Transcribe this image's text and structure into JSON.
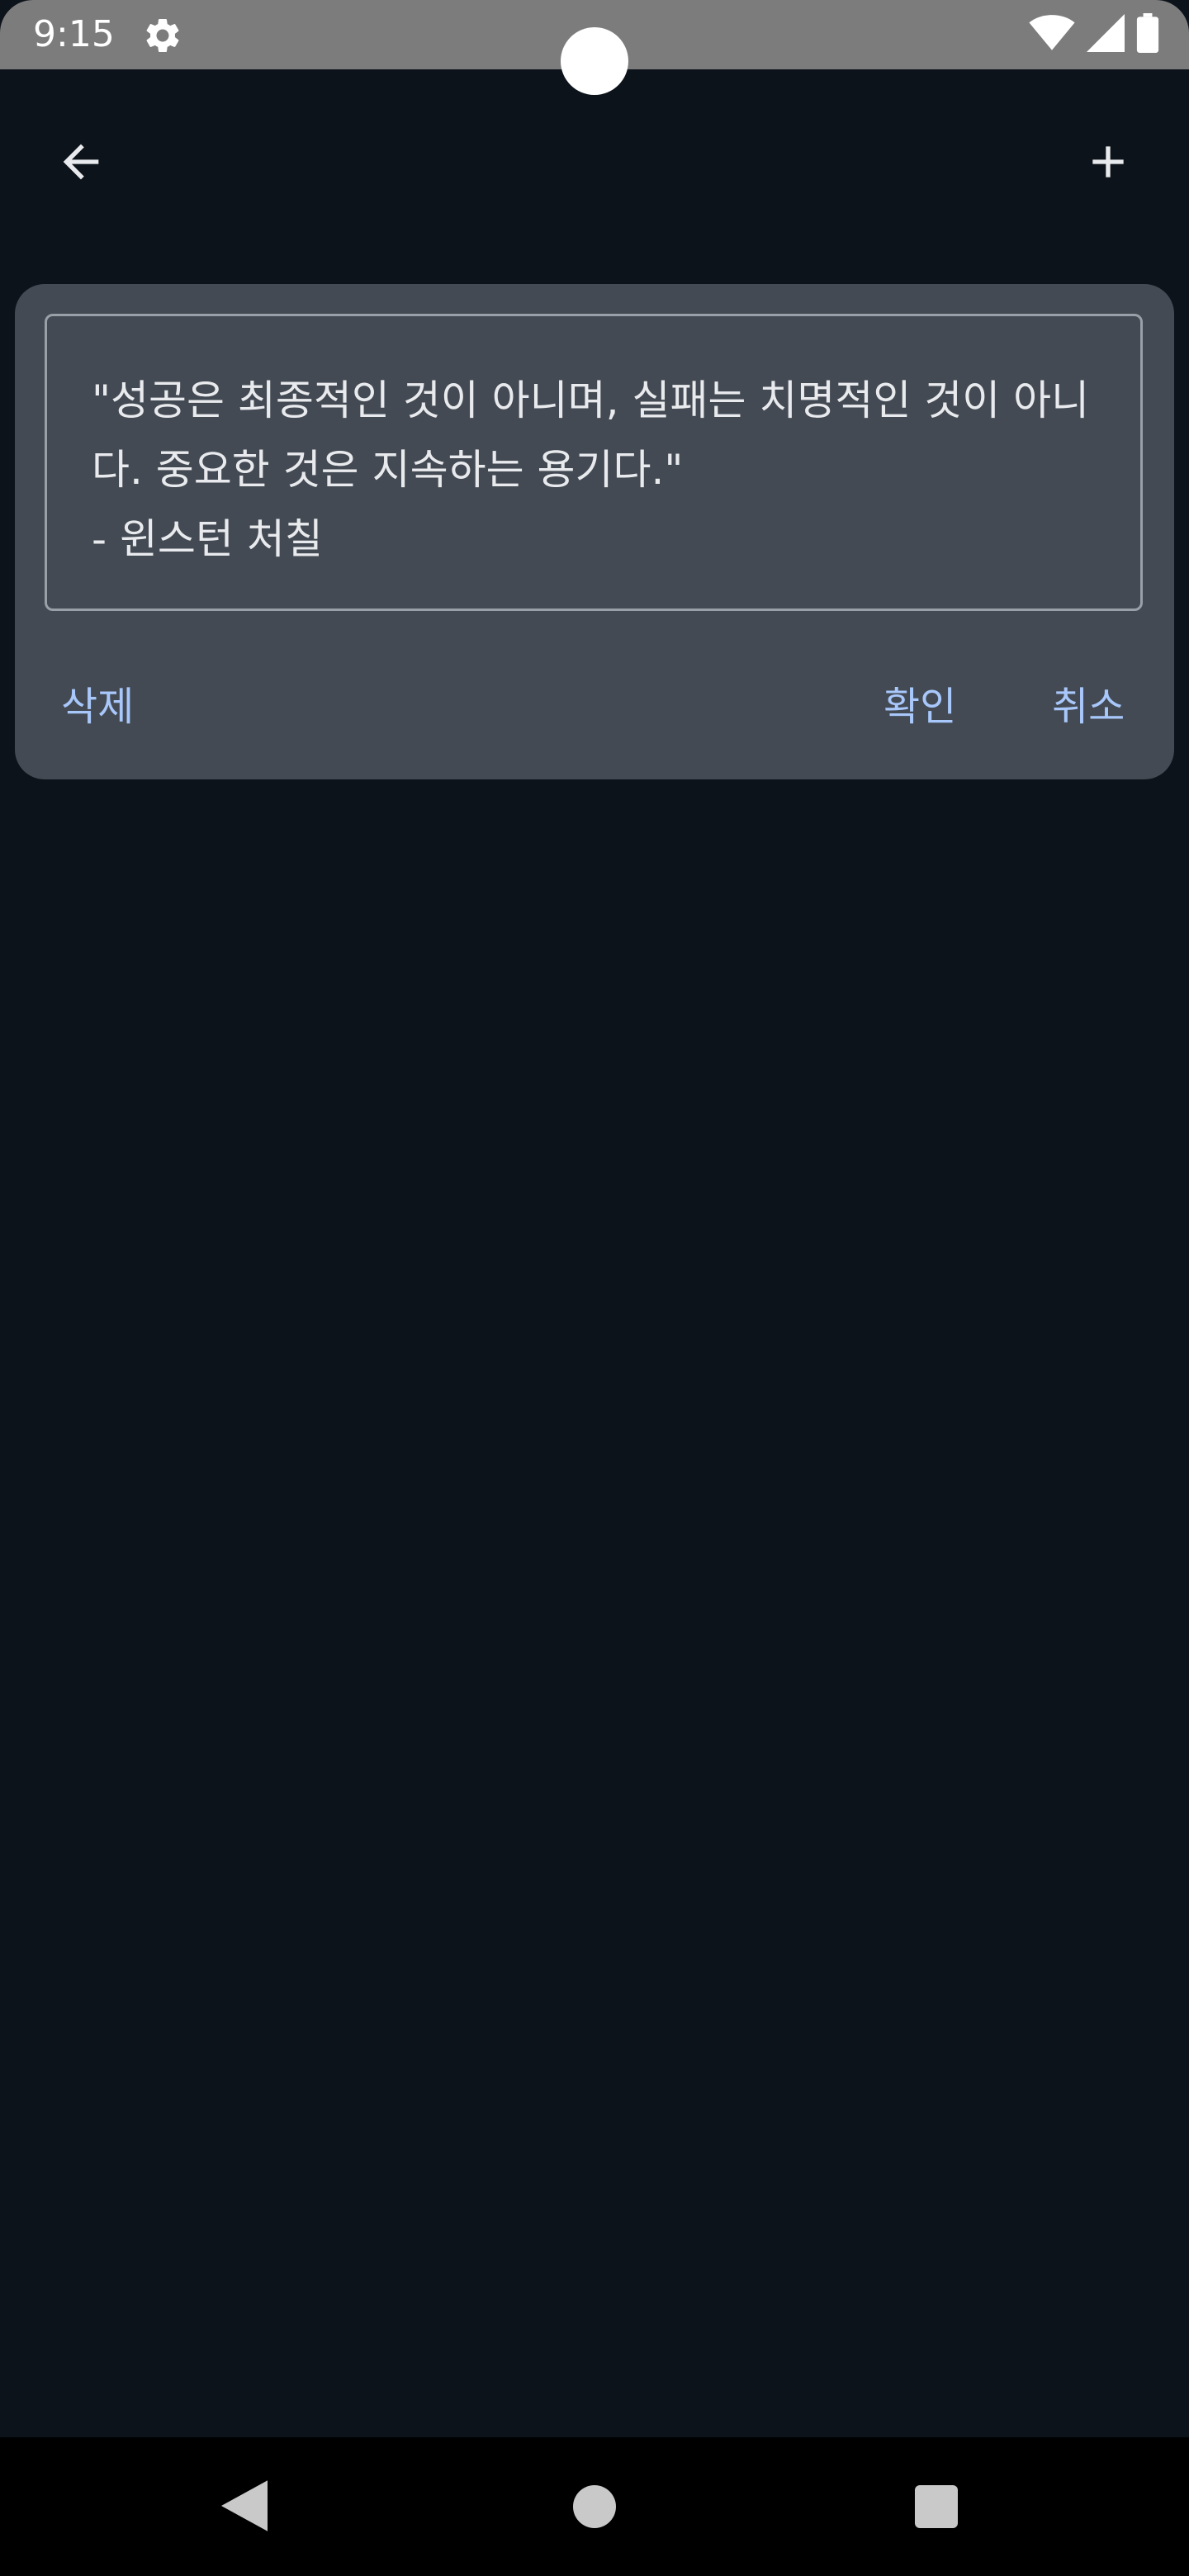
{
  "status_bar": {
    "time": "9:15",
    "icons": [
      "gear-icon",
      "wifi-icon",
      "signal-icon",
      "battery-icon"
    ]
  },
  "app_bar": {
    "back_icon": "arrow-back-icon",
    "add_icon": "plus-icon"
  },
  "dialog": {
    "quote_text": "\"성공은 최종적인 것이 아니며, 실패는 치명적인 것이 아니다. 중요한 것은 지속하는 용기다.\"\n- 윈스턴 처칠",
    "delete_label": "삭제",
    "confirm_label": "확인",
    "cancel_label": "취소"
  },
  "nav_bar": {
    "icons": [
      "nav-back-icon",
      "nav-home-icon",
      "nav-recents-icon"
    ]
  },
  "colors": {
    "background": "#0d131a",
    "card": "#434a53",
    "accent": "#a8c7fa",
    "status_bar": "#7c7c7c"
  }
}
